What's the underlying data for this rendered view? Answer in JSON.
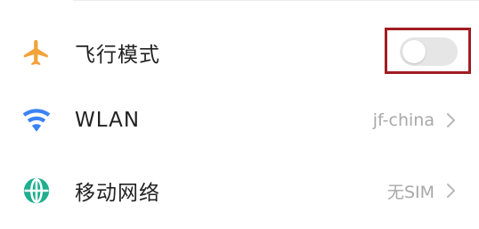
{
  "settings": {
    "items": [
      {
        "label": "飞行模式",
        "icon": "airplane-icon",
        "toggle_on": false
      },
      {
        "label": "WLAN",
        "icon": "wifi-icon",
        "value": "jf-china"
      },
      {
        "label": "移动网络",
        "icon": "globe-icon",
        "value": "无SIM"
      }
    ]
  },
  "colors": {
    "airplane_icon": "#f2a33a",
    "wifi_icon": "#3b82f6",
    "globe_icon": "#1fae8e",
    "highlight_border": "#a11d22",
    "toggle_track": "#e6e6e6"
  }
}
